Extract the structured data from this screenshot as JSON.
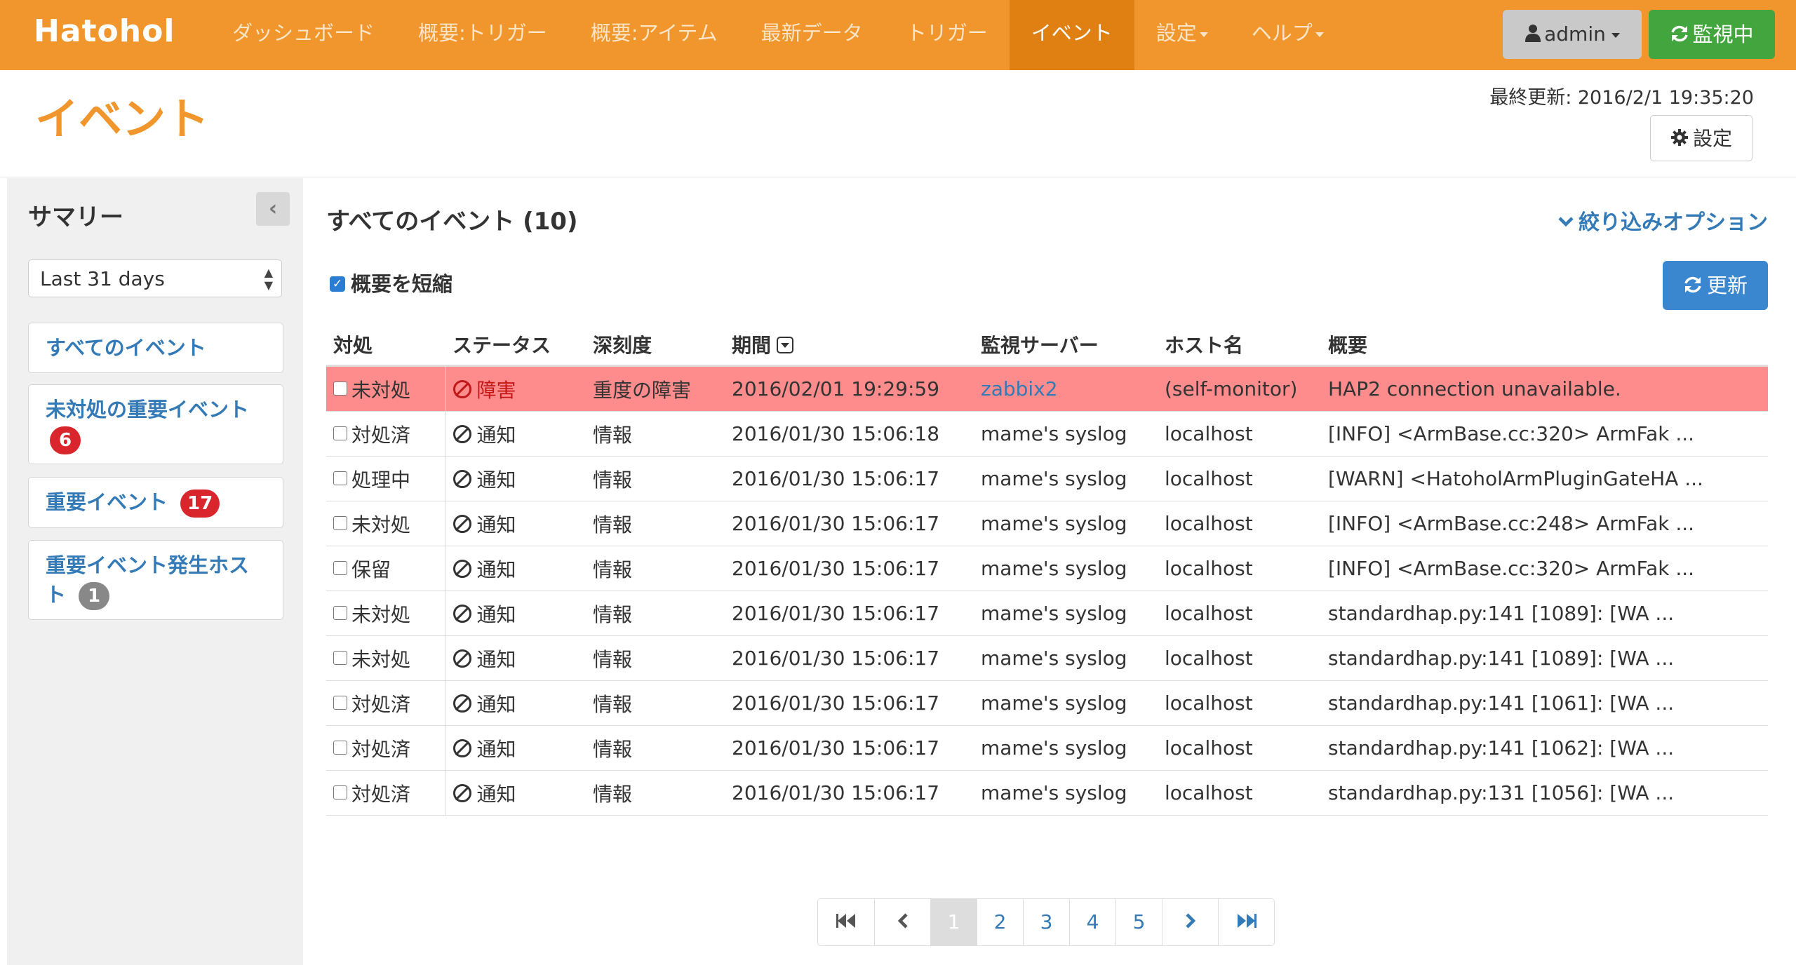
{
  "navbar": {
    "brand": "Hatohol",
    "items": [
      {
        "label": "ダッシュボード"
      },
      {
        "label": "概要:トリガー"
      },
      {
        "label": "概要:アイテム"
      },
      {
        "label": "最新データ"
      },
      {
        "label": "トリガー"
      },
      {
        "label": "イベント"
      },
      {
        "label": "設定"
      },
      {
        "label": "ヘルプ"
      }
    ],
    "user": "admin",
    "monitoring": "監視中"
  },
  "header": {
    "title": "イベント",
    "last_update": "最終更新: 2016/2/1 19:35:20",
    "settings": "設定"
  },
  "sidebar": {
    "title": "サマリー",
    "period": "Last 31 days",
    "items": [
      {
        "label": "すべてのイベント"
      },
      {
        "label": "未対処の重要イベント",
        "badge": "6"
      },
      {
        "label": "重要イベント",
        "badge": "17"
      },
      {
        "label": "重要イベント発生ホスト",
        "badge": "1"
      }
    ]
  },
  "main": {
    "title": "すべてのイベント (10)",
    "filter_option": "絞り込みオプション",
    "compact_label": "概要を短縮",
    "refresh": "更新",
    "columns": [
      "対処",
      "ステータス",
      "深刻度",
      "期間",
      "監視サーバー",
      "ホスト名",
      "概要"
    ],
    "rows": [
      {
        "handling": "未対処",
        "status": "障害",
        "severity": "重度の障害",
        "time": "2016/02/01 19:29:59",
        "server": "zabbix2",
        "host": "(self-monitor)",
        "summary": "HAP2 connection unavailable."
      },
      {
        "handling": "対処済",
        "status": "通知",
        "severity": "情報",
        "time": "2016/01/30 15:06:18",
        "server": "mame's syslog",
        "host": "localhost",
        "summary": "[INFO] <ArmBase.cc:320> ArmFak ..."
      },
      {
        "handling": "処理中",
        "status": "通知",
        "severity": "情報",
        "time": "2016/01/30 15:06:17",
        "server": "mame's syslog",
        "host": "localhost",
        "summary": "[WARN] <HatoholArmPluginGateHA ..."
      },
      {
        "handling": "未対処",
        "status": "通知",
        "severity": "情報",
        "time": "2016/01/30 15:06:17",
        "server": "mame's syslog",
        "host": "localhost",
        "summary": "[INFO] <ArmBase.cc:248> ArmFak ..."
      },
      {
        "handling": "保留",
        "status": "通知",
        "severity": "情報",
        "time": "2016/01/30 15:06:17",
        "server": "mame's syslog",
        "host": "localhost",
        "summary": "[INFO] <ArmBase.cc:320> ArmFak ..."
      },
      {
        "handling": "未対処",
        "status": "通知",
        "severity": "情報",
        "time": "2016/01/30 15:06:17",
        "server": "mame's syslog",
        "host": "localhost",
        "summary": "standardhap.py:141 [1089]: [WA ..."
      },
      {
        "handling": "未対処",
        "status": "通知",
        "severity": "情報",
        "time": "2016/01/30 15:06:17",
        "server": "mame's syslog",
        "host": "localhost",
        "summary": "standardhap.py:141 [1089]: [WA ..."
      },
      {
        "handling": "対処済",
        "status": "通知",
        "severity": "情報",
        "time": "2016/01/30 15:06:17",
        "server": "mame's syslog",
        "host": "localhost",
        "summary": "standardhap.py:141 [1061]: [WA ..."
      },
      {
        "handling": "対処済",
        "status": "通知",
        "severity": "情報",
        "time": "2016/01/30 15:06:17",
        "server": "mame's syslog",
        "host": "localhost",
        "summary": "standardhap.py:141 [1062]: [WA ..."
      },
      {
        "handling": "対処済",
        "status": "通知",
        "severity": "情報",
        "time": "2016/01/30 15:06:17",
        "server": "mame's syslog",
        "host": "localhost",
        "summary": "standardhap.py:131 [1056]: [WA ..."
      }
    ]
  },
  "pagination": {
    "pages": [
      "1",
      "2",
      "3",
      "4",
      "5"
    ],
    "current": "1"
  },
  "icons": {
    "first": "first-page-icon",
    "prev": "chevron-left-icon",
    "next": "chevron-right-icon",
    "last": "last-page-icon"
  },
  "colors": {
    "brand_orange": "#f1962c",
    "active_nav": "#e07f12",
    "monitoring_green": "#43a53d",
    "link_blue": "#337ab7",
    "danger_row": "#fe8c8c",
    "badge_red": "#d9262c"
  }
}
